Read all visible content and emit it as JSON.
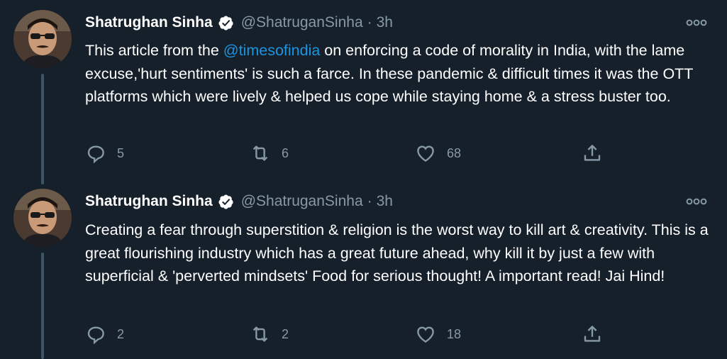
{
  "tweets": [
    {
      "author": "Shatrughan Sinha",
      "handle": "@ShatruganSinha",
      "separator": "·",
      "time": "3h",
      "text_before": "This article from the ",
      "mention": "@timesofindia",
      "text_after": " on enforcing a code of morality in India, with the lame excuse,'hurt sentiments' is such a farce. In these pandemic & difficult times it was the OTT platforms which were lively & helped us cope while staying home & a stress buster too.",
      "replies": "5",
      "retweets": "6",
      "likes": "68"
    },
    {
      "author": "Shatrughan Sinha",
      "handle": "@ShatruganSinha",
      "separator": "·",
      "time": "3h",
      "text": "Creating a fear through superstition & religion is the worst way to kill art & creativity. This is a great flourishing industry which has a great future ahead, why kill it by just a few with superficial & 'perverted  mindsets' Food for serious thought! A important read! Jai Hind!",
      "replies": "2",
      "retweets": "2",
      "likes": "18"
    }
  ],
  "icons": {
    "reply": "reply-icon",
    "retweet": "retweet-icon",
    "like": "heart-icon",
    "share": "share-icon",
    "more": "more-options-icon",
    "verified": "verified-badge-icon"
  },
  "colors": {
    "background": "#15202b",
    "text": "#ffffff",
    "muted": "#8899a6",
    "link": "#1b95e0",
    "thread_line": "#3d5466"
  }
}
